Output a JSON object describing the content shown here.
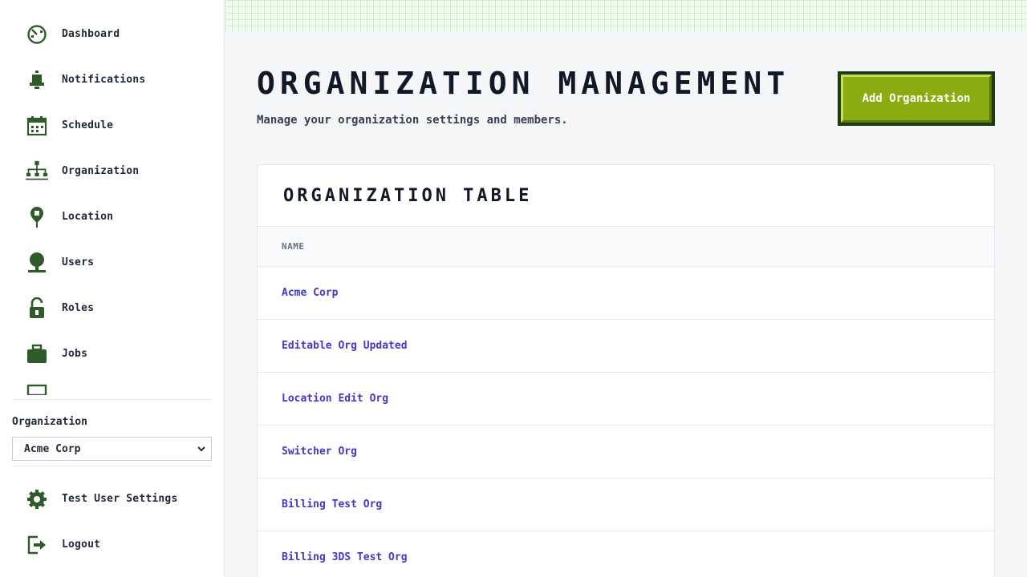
{
  "sidebar": {
    "items": [
      {
        "label": "Dashboard",
        "icon": "dashboard-icon"
      },
      {
        "label": "Notifications",
        "icon": "bell-icon"
      },
      {
        "label": "Schedule",
        "icon": "calendar-icon"
      },
      {
        "label": "Organization",
        "icon": "org-chart-icon"
      },
      {
        "label": "Location",
        "icon": "location-pin-icon"
      },
      {
        "label": "Users",
        "icon": "user-icon"
      },
      {
        "label": "Roles",
        "icon": "unlock-icon"
      },
      {
        "label": "Jobs",
        "icon": "briefcase-icon"
      }
    ],
    "org_label": "Organization",
    "org_selected": "Acme Corp",
    "settings_label": "Test User Settings",
    "logout_label": "Logout"
  },
  "main": {
    "title": "ORGANIZATION MANAGEMENT",
    "subtitle": "Manage your organization settings and members.",
    "add_button": "Add Organization",
    "table": {
      "title": "ORGANIZATION TABLE",
      "column": "NAME",
      "rows": [
        "Acme Corp",
        "Editable Org Updated",
        "Location Edit Org",
        "Switcher Org",
        "Billing Test Org",
        "Billing 3DS Test Org"
      ]
    }
  },
  "colors": {
    "icon": "#2f5a2a",
    "accent": "#8aac10",
    "link": "#4338ca"
  }
}
